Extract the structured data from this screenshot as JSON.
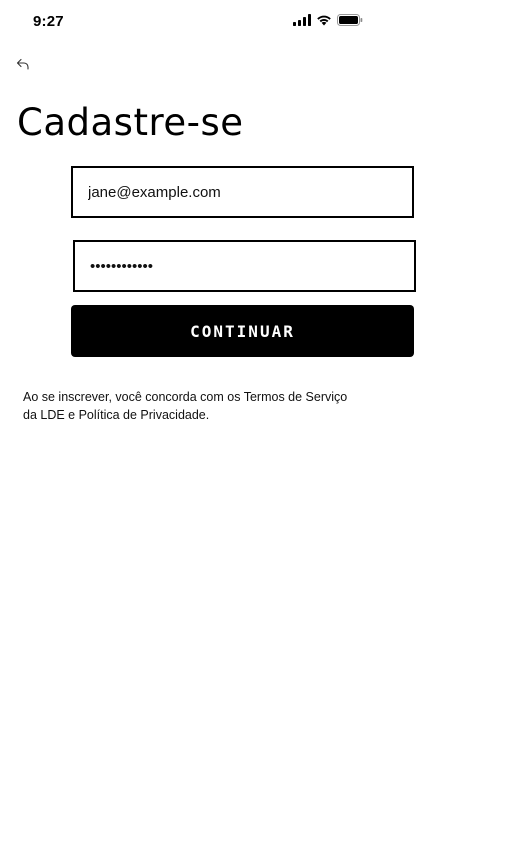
{
  "status_bar": {
    "time": "9:27"
  },
  "nav": {
    "back_icon": "back-arrow-icon"
  },
  "page": {
    "title": "Cadastre-se"
  },
  "form": {
    "email_value": "jane@example.com",
    "password_value": "••••••••••••",
    "continue_label": "CONTINUAR"
  },
  "footer": {
    "terms_line1": "Ao se inscrever, você concorda com os Termos de Serviço",
    "terms_line2": "da LDE e Política de Privacidade."
  },
  "colors": {
    "button_background": "#000000",
    "button_text": "#ffffff",
    "border": "#000000"
  }
}
